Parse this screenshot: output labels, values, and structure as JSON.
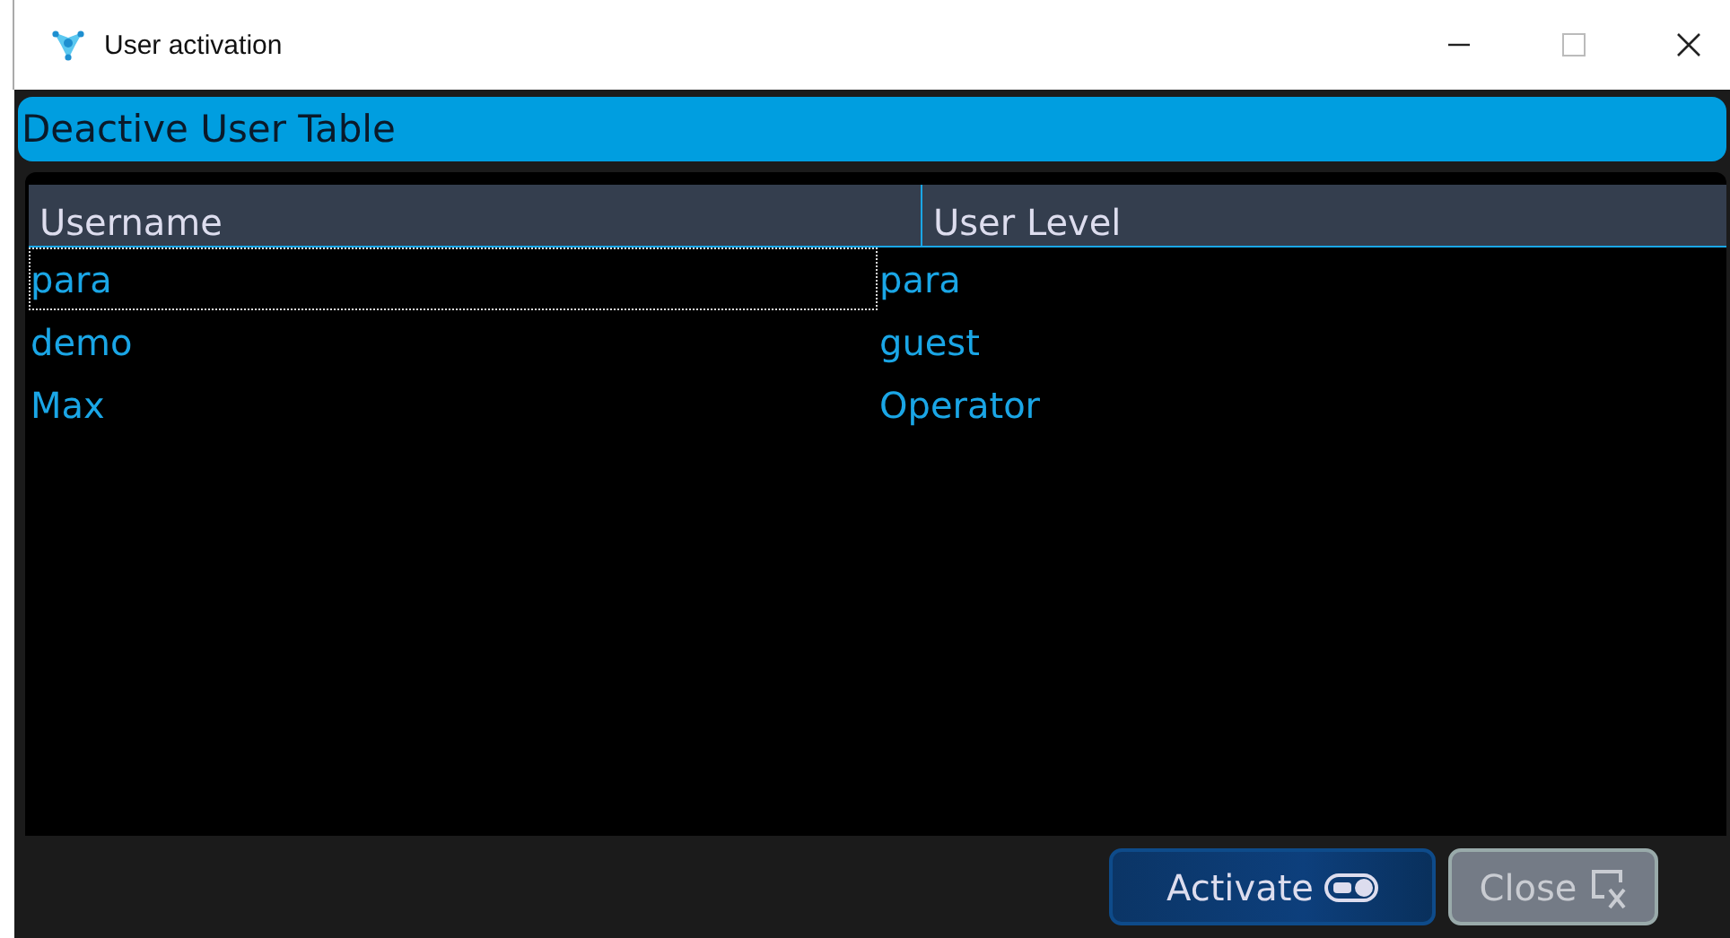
{
  "window": {
    "title": "User activation"
  },
  "section_title": "Deactive User Table",
  "table": {
    "columns": [
      "Username",
      "User Level"
    ],
    "rows": [
      {
        "username": "para",
        "user_level": "para",
        "focused": true
      },
      {
        "username": "demo",
        "user_level": "guest",
        "focused": false
      },
      {
        "username": "Max",
        "user_level": "Operator",
        "focused": false
      }
    ]
  },
  "buttons": [
    {
      "kind": "activate",
      "label": "Activate",
      "disabled": false
    },
    {
      "kind": "close",
      "label": "Close",
      "disabled": true
    }
  ]
}
